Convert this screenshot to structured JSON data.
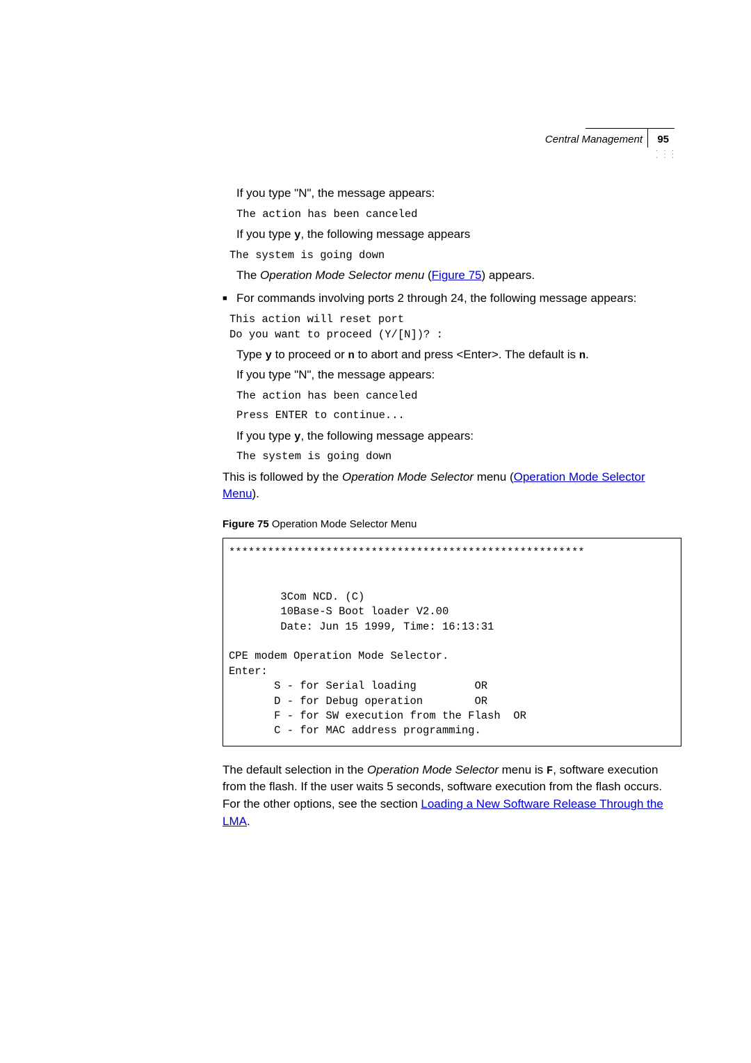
{
  "header": {
    "section": "Central Management",
    "page": "95"
  },
  "p1": " If you type \"N\", the message appears:",
  "code1": "The action has been canceled",
  "p2a": " If you type ",
  "p2b": "y",
  "p2c": ", the following message appears",
  "code2": "The system is going down",
  "p3a": " The ",
  "p3b": "Operation Mode Selector menu",
  "p3c": " (",
  "p3d": "Figure 75",
  "p3e": ") appears.",
  "bullet1": "For commands involving ports 2 through 24, the following message appears:",
  "code3": "This action will reset port\nDo you want to proceed (Y/[N])? :",
  "p4a": "Type ",
  "p4b": "y",
  "p4c": "  to proceed or ",
  "p4d": "n",
  "p4e": " to abort and press <Enter>. The default is ",
  "p4f": "n",
  "p4g": ".",
  "p5": "If you type \"N\", the message appears:",
  "code4": "The action has been canceled",
  "code5": "Press ENTER to continue...",
  "p6a": "If you type ",
  "p6b": "y",
  "p6c": ", the following message appears:",
  "code6": "The system is going down",
  "p7a": "This is followed by the ",
  "p7b": "Operation Mode Selector",
  "p7c": " menu (",
  "p7d": "Operation Mode Selector Menu",
  "p7e": ").",
  "fig": {
    "label": "Figure 75",
    "title": "   Operation Mode Selector Menu"
  },
  "codebox": "*******************************************************\n\n\n        3Com NCD. (C)\n        10Base-S Boot loader V2.00\n        Date: Jun 15 1999, Time: 16:13:31\n\nCPE modem Operation Mode Selector.\nEnter:\n       S - for Serial loading         OR\n       D - for Debug operation        OR\n       F - for SW execution from the Flash  OR\n       C - for MAC address programming.\n",
  "p8a": "The default selection in the ",
  "p8b": "Operation Mode Selector",
  "p8c": " menu is ",
  "p8d": "F",
  "p8e": ", software execution from the flash. If the user waits 5 seconds, software execution from the flash occurs. For the other options, see the section ",
  "p8f": "Loading a New Software Release Through the LMA",
  "p8g": "."
}
